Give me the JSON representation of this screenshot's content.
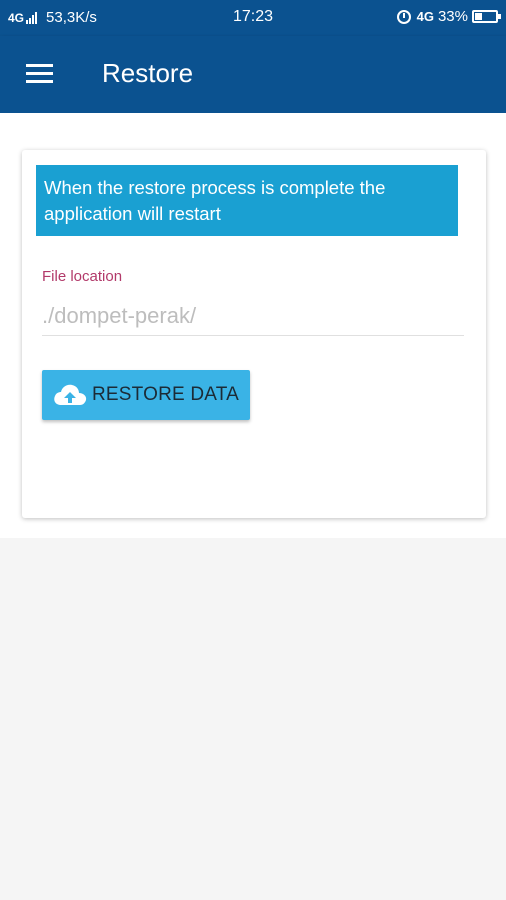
{
  "status_bar": {
    "network": "4G",
    "speed": "53,3K/s",
    "time": "17:23",
    "network2": "4G",
    "battery_percent": "33%",
    "battery_level": 0.33,
    "icons": [
      "signal-icon",
      "alarm-icon",
      "battery-icon"
    ]
  },
  "app_bar": {
    "title": "Restore",
    "menu_icon": "hamburger-menu-icon"
  },
  "card": {
    "info_message": "When the restore process is complete the application will restart",
    "file_location": {
      "label": "File location",
      "placeholder": "./dompet-perak/",
      "value": ""
    },
    "restore_button": {
      "label": "RESTORE DATA",
      "icon": "cloud-upload-icon"
    }
  },
  "colors": {
    "primary": "#0b5290",
    "banner": "#1aa0d2",
    "button": "#3ab3e6",
    "label": "#b23a6a"
  }
}
